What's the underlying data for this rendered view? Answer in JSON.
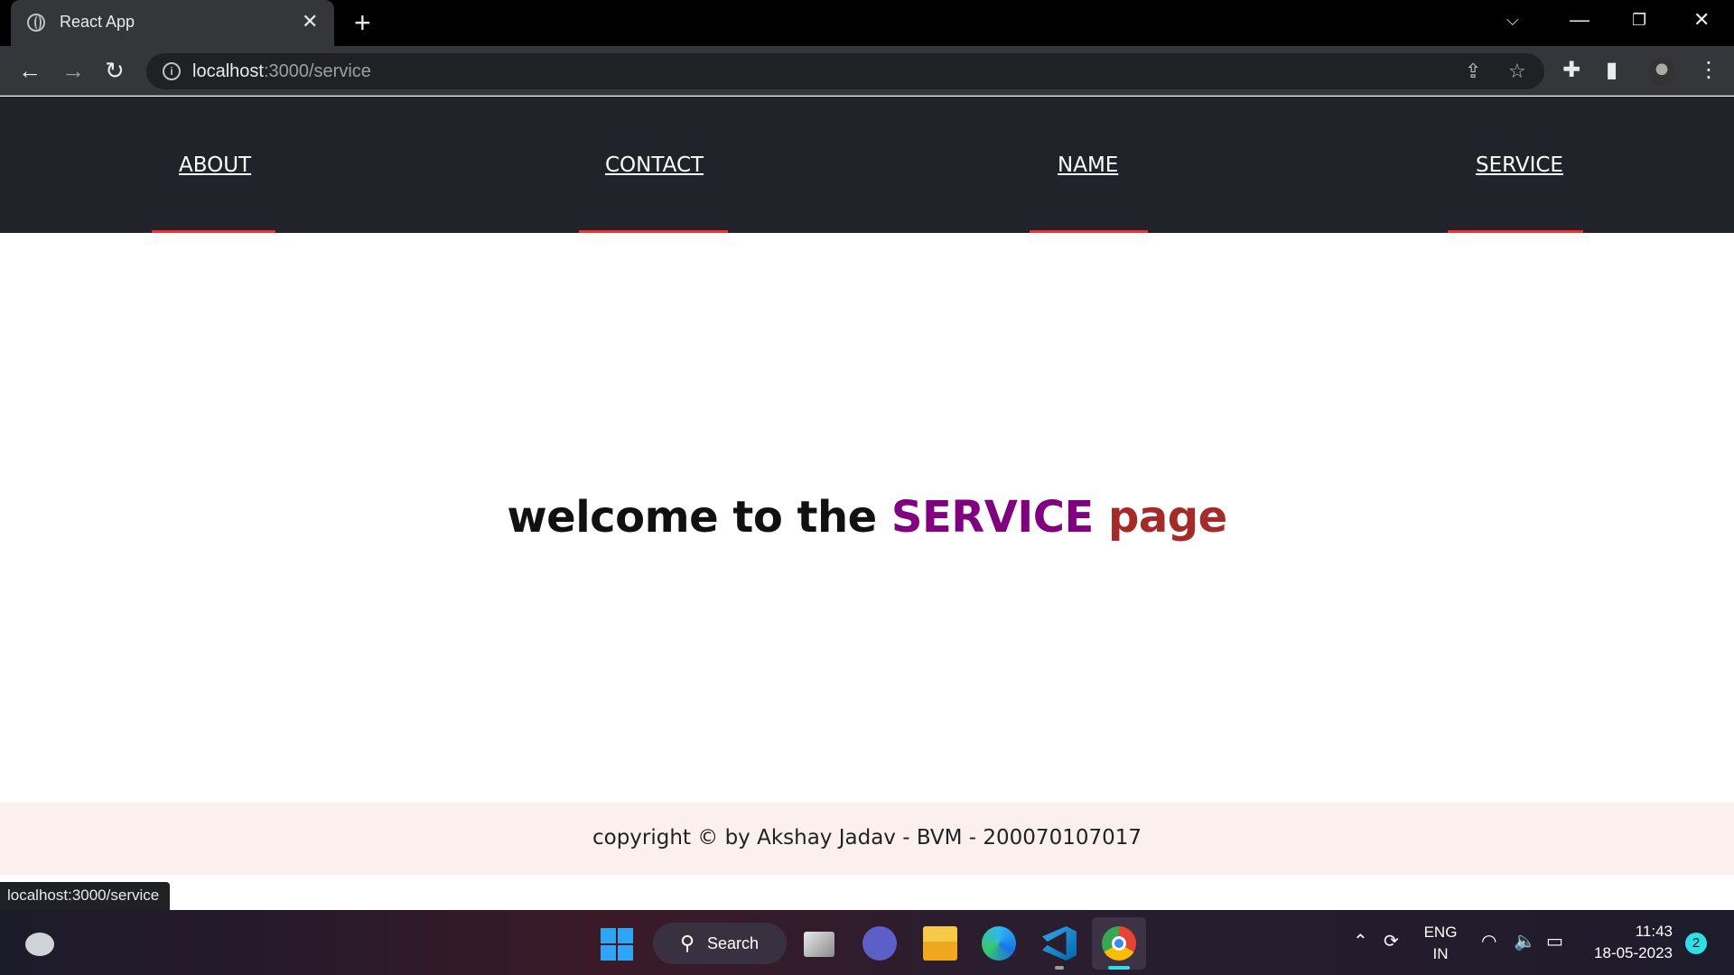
{
  "browser": {
    "tab_title": "React App",
    "new_tab_symbol": "+",
    "close_symbol": "✕",
    "url_host": "localhost",
    "url_path": ":3000/service",
    "status_url": "localhost:3000/service"
  },
  "nav": {
    "links": [
      "ABOUT",
      "CONTACT",
      "NAME",
      "SERVICE"
    ],
    "underline_color": "#ff2a2a",
    "background": "#20232a"
  },
  "main": {
    "welcome_prefix": "welcome to the",
    "welcome_highlight": "SERVICE",
    "welcome_suffix": "page",
    "highlight_color": "#800080",
    "suffix_color": "#a52a2a"
  },
  "footer": {
    "text": "copyright © by Akshay Jadav - BVM - 200070107017"
  },
  "taskbar": {
    "search_label": "Search",
    "lang_line1": "ENG",
    "lang_line2": "IN",
    "time": "11:43",
    "date": "18-05-2023",
    "notification_count": "2",
    "apps": [
      "task-view-icon",
      "teams-icon",
      "file-explorer-icon",
      "edge-icon",
      "vscode-icon",
      "chrome-icon"
    ]
  }
}
